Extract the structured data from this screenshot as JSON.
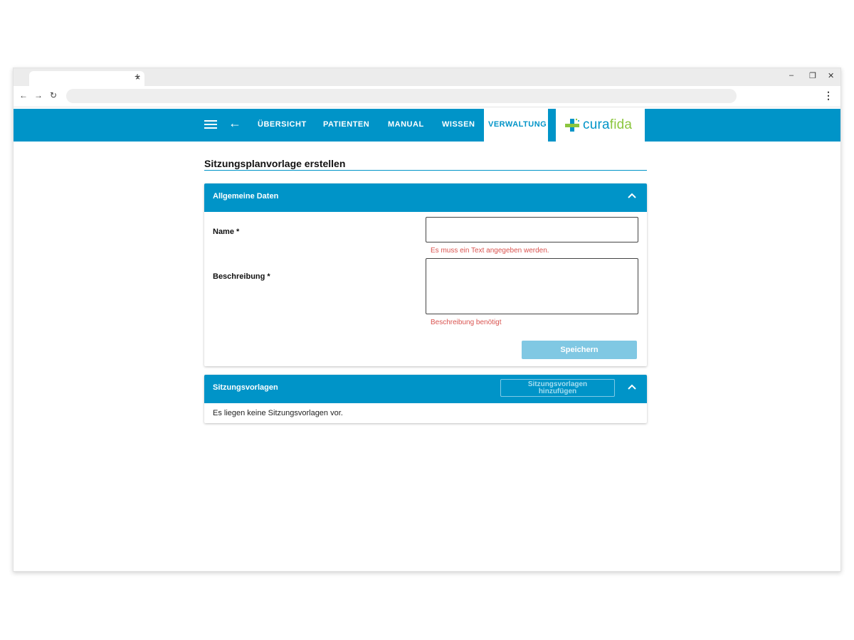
{
  "browser": {
    "tab_close": "×",
    "new_tab": "+",
    "minimize": "–",
    "restore": "❐",
    "close": "✕",
    "back": "←",
    "forward": "→",
    "reload": "↻",
    "menu": "⋮"
  },
  "header": {
    "nav": [
      "ÜBERSICHT",
      "PATIENTEN",
      "MANUAL",
      "WISSEN"
    ],
    "active": "VERWALTUNG",
    "back_arrow": "←",
    "logo_cura": "cura",
    "logo_fida": "fida"
  },
  "colors": {
    "primary": "#0094c8",
    "accent": "#8cc63f",
    "error": "#d9534f",
    "disabled": "#80c8e3"
  },
  "page": {
    "title": "Sitzungsplanvorlage erstellen"
  },
  "general": {
    "title": "Allgemeine Daten",
    "name_label": "Name *",
    "name_value": "",
    "name_error": "Es muss ein Text angegeben werden.",
    "desc_label": "Beschreibung *",
    "desc_value": "",
    "desc_error": "Beschreibung benötigt",
    "save_label": "Speichern"
  },
  "sessions": {
    "title": "Sitzungsvorlagen",
    "add_line1": "Sitzungsvorlagen",
    "add_line2": "hinzufügen",
    "empty": "Es liegen keine Sitzungsvorlagen vor."
  }
}
